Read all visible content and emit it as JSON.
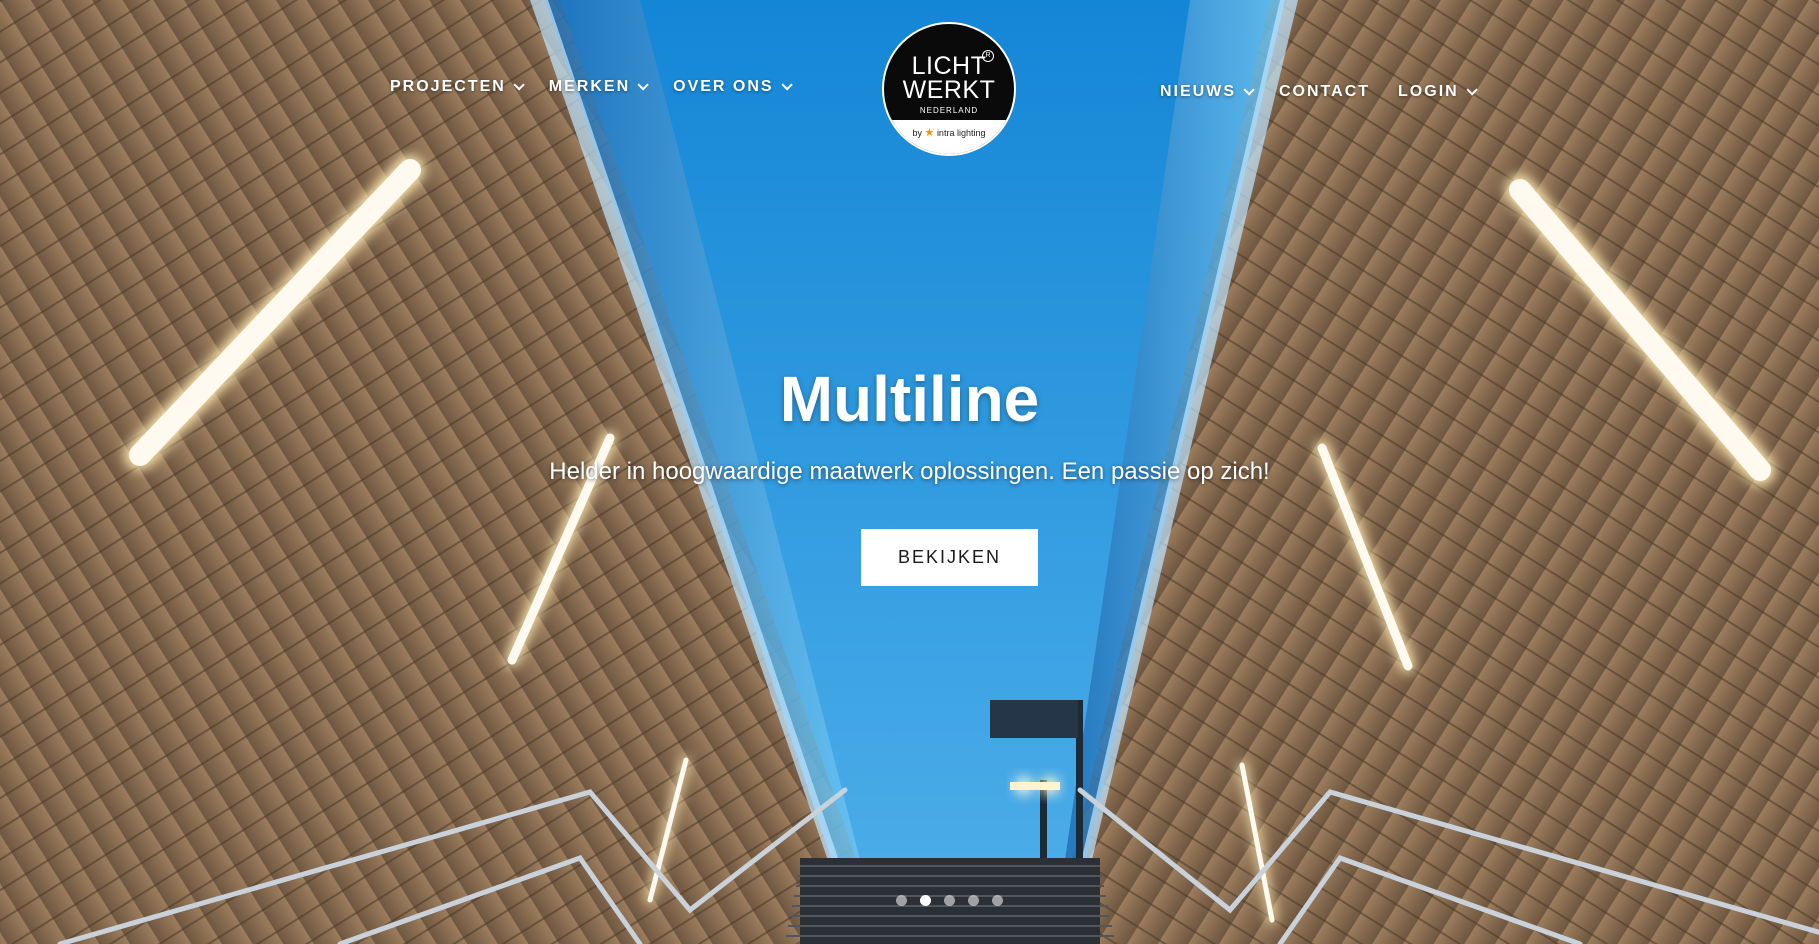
{
  "nav": {
    "left": [
      {
        "label": "PROJECTEN",
        "has_dropdown": true
      },
      {
        "label": "MERKEN",
        "has_dropdown": true
      },
      {
        "label": "OVER ONS",
        "has_dropdown": true
      }
    ],
    "right": [
      {
        "label": "NIEUWS",
        "has_dropdown": true
      },
      {
        "label": "CONTACT",
        "has_dropdown": false
      },
      {
        "label": "LOGIN",
        "has_dropdown": true
      }
    ]
  },
  "logo": {
    "line1": "LICHT",
    "line2": "WERKT",
    "registered": "R",
    "subtitle": "NEDERLAND",
    "by": "by",
    "brand": "intra lighting",
    "icon": "star-icon"
  },
  "hero": {
    "title": "Multiline",
    "subtitle": "Helder in hoogwaardige maatwerk oplossingen. Een passie op zich!",
    "cta_label": "BEKIJKEN"
  },
  "slider": {
    "total": 5,
    "active_index": 2
  },
  "colors": {
    "sky": "#1b8fd8",
    "wood": "#8a6a4a",
    "light": "#fff6d8",
    "logo_accent": "#f39200"
  }
}
